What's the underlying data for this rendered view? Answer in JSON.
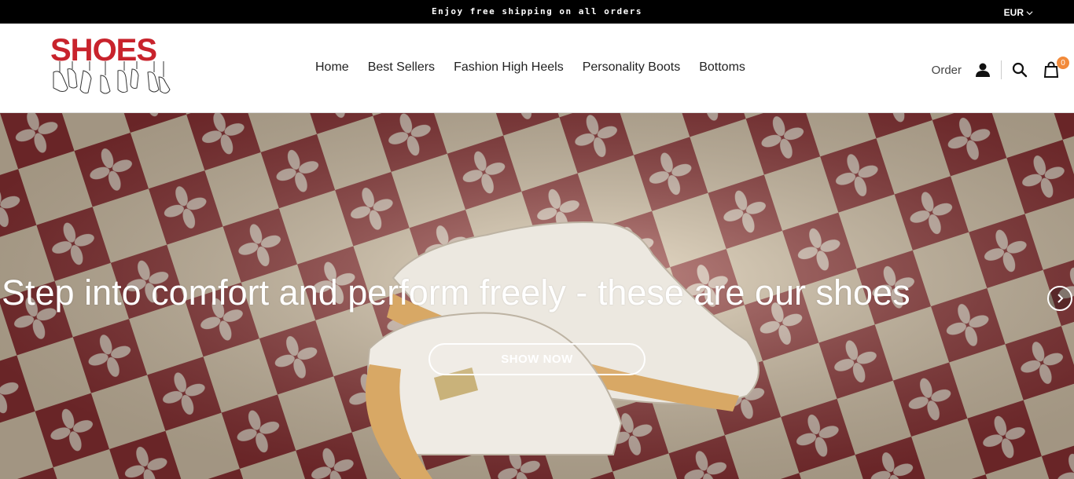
{
  "announcement": {
    "text": "Enjoy free shipping on all orders"
  },
  "currency": {
    "label": "EUR",
    "icon": "chevron-down-icon"
  },
  "logo": {
    "text": "SHOES",
    "color": "#c8232c"
  },
  "nav": {
    "items": [
      {
        "label": "Home"
      },
      {
        "label": "Best Sellers"
      },
      {
        "label": "Fashion High Heels"
      },
      {
        "label": "Personality Boots"
      },
      {
        "label": "Bottoms"
      }
    ]
  },
  "actions": {
    "order_label": "Order",
    "account_icon": "user-icon",
    "search_icon": "search-icon",
    "cart_icon": "shopping-bag-icon",
    "cart_count": "0",
    "badge_color": "#f28a3a"
  },
  "hero": {
    "title": "Step into comfort and perform freely - these are our shoes",
    "cta_label": "SHOW NOW",
    "next_icon": "chevron-right-icon"
  }
}
